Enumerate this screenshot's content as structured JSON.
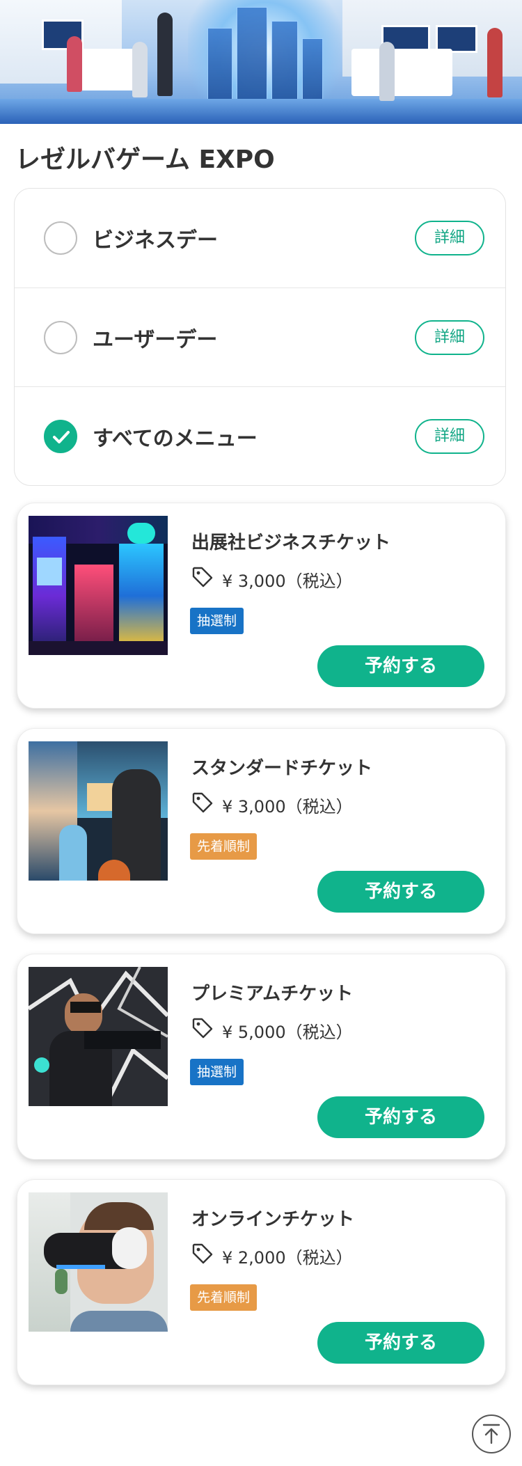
{
  "header": {
    "title": "レゼルバゲーム EXPO"
  },
  "menu": {
    "items": [
      {
        "label": "ビジネスデー",
        "selected": false,
        "detail_label": "詳細"
      },
      {
        "label": "ユーザーデー",
        "selected": false,
        "detail_label": "詳細"
      },
      {
        "label": "すべてのメニュー",
        "selected": true,
        "detail_label": "詳細"
      }
    ]
  },
  "tickets": [
    {
      "name": "出展社ビジネスチケット",
      "price": "¥ 3,000（税込）",
      "badge": "抽選制",
      "badge_type": "lottery",
      "button": "予約する",
      "image": "arcade-machines-photo"
    },
    {
      "name": "スタンダードチケット",
      "price": "¥ 3,000（税込）",
      "badge": "先着順制",
      "badge_type": "first-come",
      "button": "予約する",
      "image": "parent-child-arcade-photo"
    },
    {
      "name": "プレミアムチケット",
      "price": "¥ 5,000（税込）",
      "badge": "抽選制",
      "badge_type": "lottery",
      "button": "予約する",
      "image": "vr-gamer-photo"
    },
    {
      "name": "オンラインチケット",
      "price": "¥ 2,000（税込）",
      "badge": "先着順制",
      "badge_type": "first-come",
      "button": "予約する",
      "image": "child-vr-headset-photo"
    }
  ],
  "icons": {
    "price": "price-tag-icon",
    "check": "checkmark-icon",
    "scroll_top": "arrow-up-icon"
  },
  "colors": {
    "accent": "#10b38c",
    "lottery_badge": "#1873c6",
    "first_come_badge": "#e79a46",
    "text": "#333333"
  }
}
